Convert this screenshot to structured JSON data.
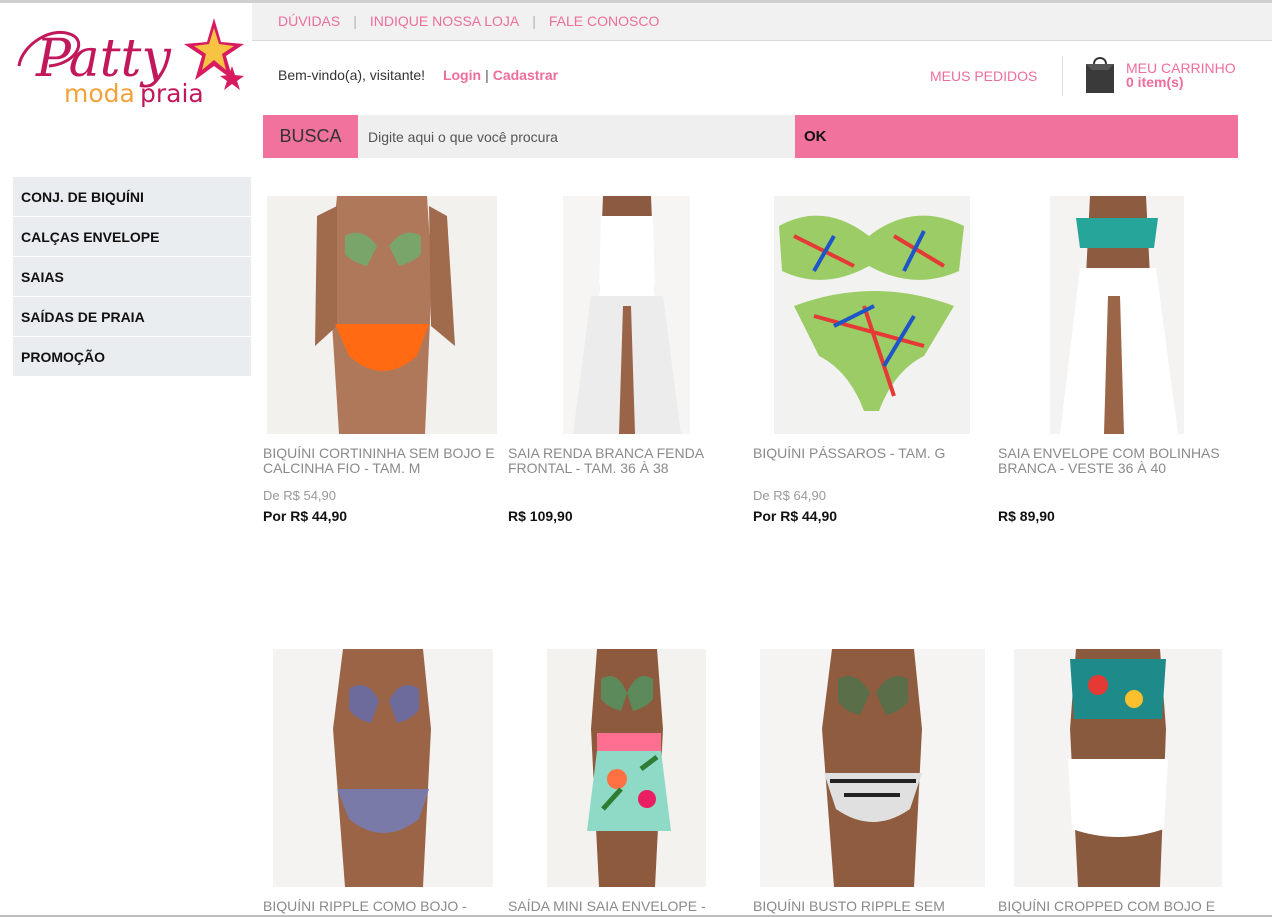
{
  "brand": {
    "logo_line1": "Patty",
    "logo_line2a": "moda",
    "logo_line2b": "praia",
    "colors": {
      "pink": "#f0729d",
      "magenta": "#c2185b",
      "star_red": "#d81b60",
      "star_yellow": "#f6c343"
    }
  },
  "topnav": [
    "DÚVIDAS",
    "INDIQUE NOSSA LOJA",
    "FALE CONOSCO"
  ],
  "header": {
    "welcome": "Bem-vindo(a), visitante!",
    "login": "Login",
    "separator": "|",
    "register": "Cadastrar",
    "orders": "MEUS PEDIDOS",
    "cart_label": "MEU CARRINHO",
    "cart_count": "0 item(s)"
  },
  "search": {
    "label": "BUSCA",
    "placeholder": "Digite aqui o que você procura",
    "button": "OK"
  },
  "categories": [
    "CONJ. DE BIQUÍNI",
    "CALÇAS ENVELOPE",
    "SAIAS",
    "SAÍDAS DE PRAIA",
    "PROMOÇÃO"
  ],
  "products": [
    {
      "name": "BIQUÍNI CORTININHA SEM BOJO E CALCINHA FIO - TAM. M",
      "old_price": "De R$ 54,90",
      "price": "Por R$ 44,90",
      "image": "bikini-orange-bottom"
    },
    {
      "name": "SAIA RENDA BRANCA FENDA FRONTAL - TAM. 36 À 38",
      "old_price": "",
      "price": "R$ 109,90",
      "image": "white-lace-skirt"
    },
    {
      "name": "BIQUÍNI PÁSSAROS - TAM. G",
      "old_price": "De R$ 64,90",
      "price": "Por R$ 44,90",
      "image": "green-print-bikini"
    },
    {
      "name": "SAIA ENVELOPE COM BOLINHAS BRANCA - VESTE 36 À 40",
      "old_price": "",
      "price": "R$ 89,90",
      "image": "white-wrap-skirt"
    },
    {
      "name": "BIQUÍNI RIPPLE COMO BOJO -",
      "old_price": "",
      "price": "",
      "image": "ripple-bikini"
    },
    {
      "name": "SAÍDA MINI SAIA ENVELOPE -",
      "old_price": "",
      "price": "",
      "image": "floral-mini-skirt"
    },
    {
      "name": "BIQUÍNI BUSTO RIPPLE SEM",
      "old_price": "",
      "price": "",
      "image": "busto-ripple-bikini"
    },
    {
      "name": "BIQUÍNI CROPPED COM BOJO E",
      "old_price": "",
      "price": "",
      "image": "cropped-bikini"
    }
  ]
}
